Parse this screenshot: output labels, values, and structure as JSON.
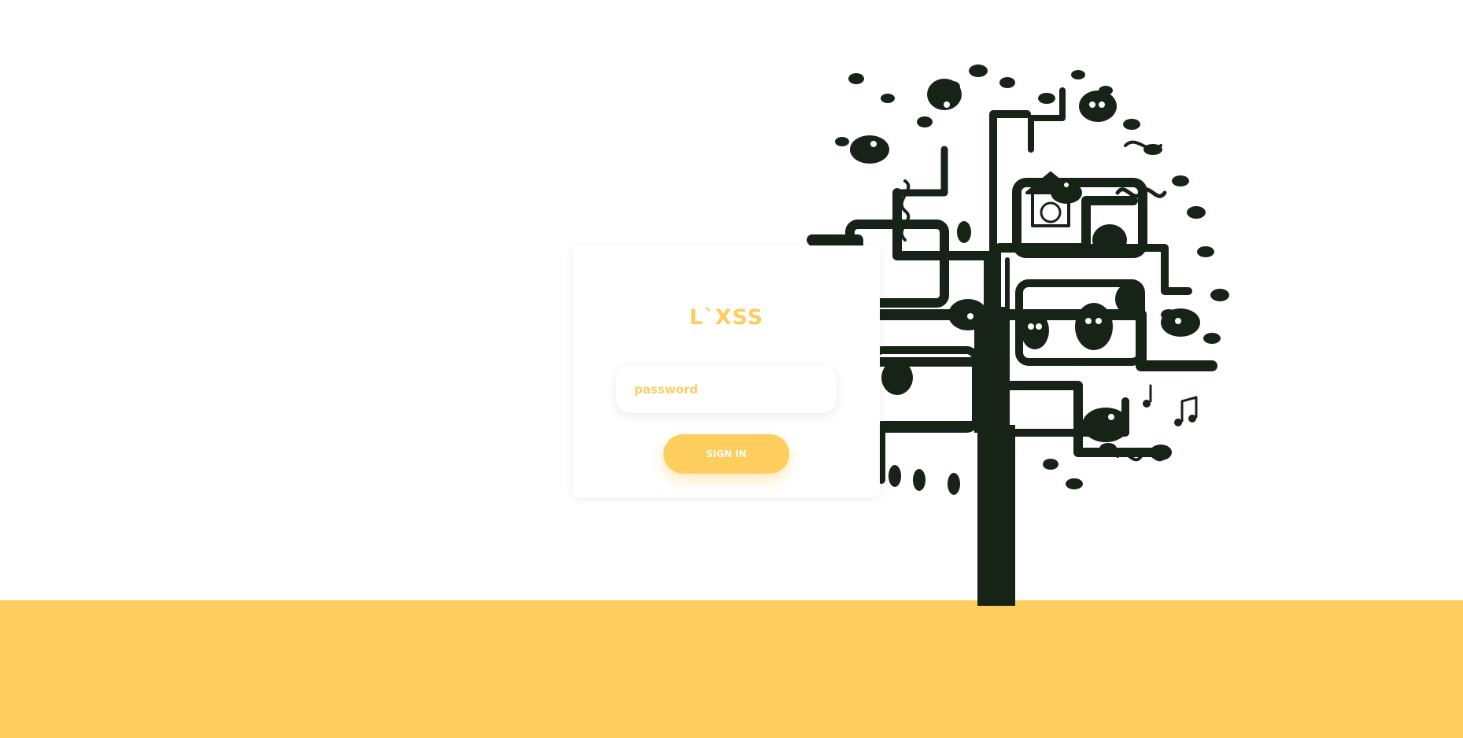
{
  "login": {
    "title": "L`XSS",
    "password_placeholder": "password",
    "password_value": "",
    "sign_in_label": "SIGN IN"
  },
  "colors": {
    "accent": "#fdcd5d",
    "tree": "#172317",
    "background": "#ffffff"
  },
  "illustration": {
    "name": "tree-with-animals-illustration"
  }
}
